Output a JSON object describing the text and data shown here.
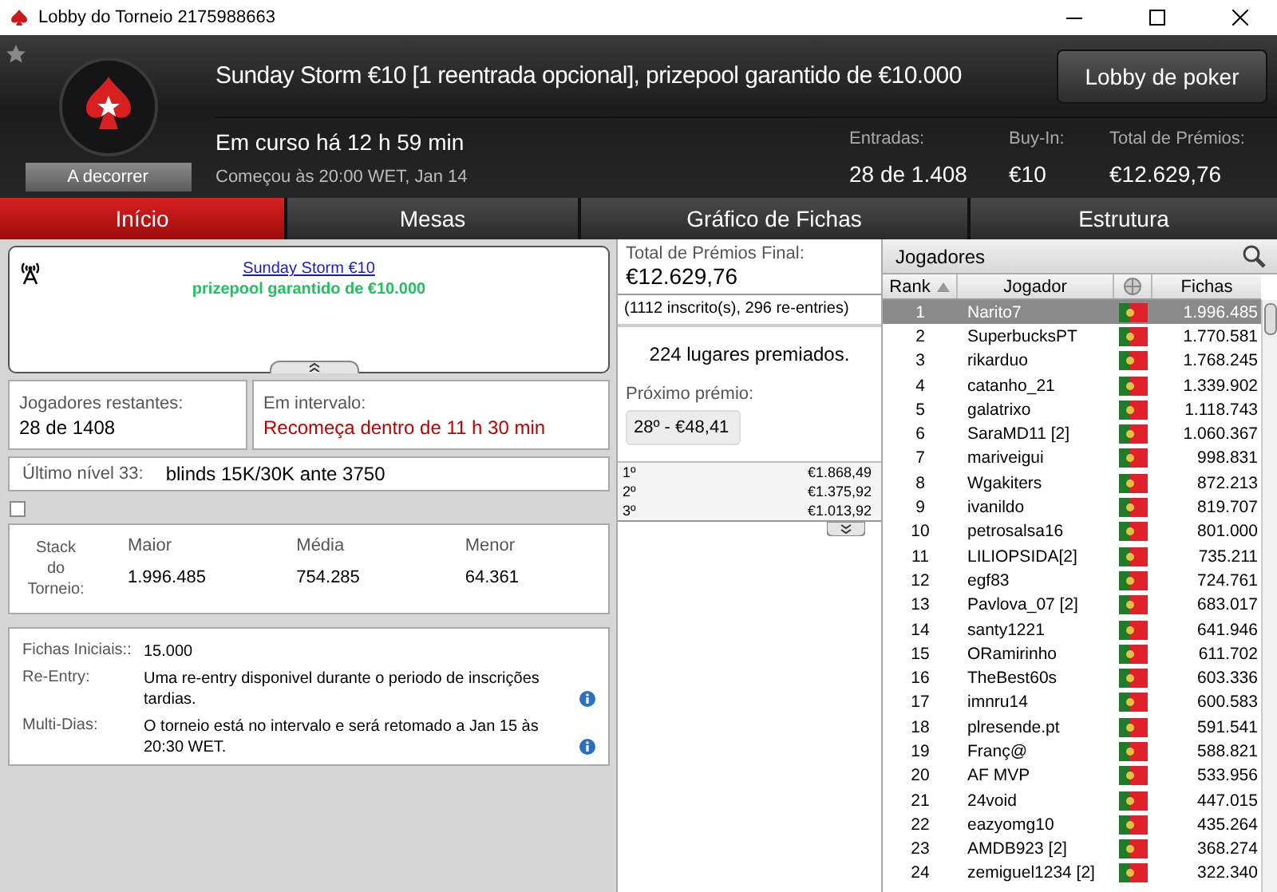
{
  "window": {
    "title": "Lobby do Torneio 2175988663"
  },
  "header": {
    "title": "Sunday Storm €10 [1 reentrada opcional], prizepool garantido de €10.000",
    "status_label": "A decorrer",
    "running": "Em curso há 12 h 59 min",
    "started": "Começou às 20:00 WET, Jan 14",
    "lobby_button": "Lobby de poker",
    "stats": [
      {
        "label": "Entradas:",
        "value": "28 de 1.408"
      },
      {
        "label": "Buy-In:",
        "value": "€10"
      },
      {
        "label": "Total de Prémios:",
        "value": "€12.629,76"
      }
    ]
  },
  "tabs": [
    {
      "label": "Início",
      "selected": true
    },
    {
      "label": "Mesas",
      "selected": false
    },
    {
      "label": "Gráfico de Fichas",
      "selected": false
    },
    {
      "label": "Estrutura",
      "selected": false
    }
  ],
  "news": {
    "link": "Sunday Storm €10",
    "subtitle": "prizepool garantido de €10.000"
  },
  "players_remaining": {
    "label": "Jogadores restantes:",
    "value": "28 de 1408"
  },
  "break": {
    "label": "Em intervalo:",
    "value": "Recomeça dentro de 11 h 30 min"
  },
  "last_level": {
    "label": "Último nível 33:",
    "value": "blinds 15K/30K ante 3750"
  },
  "option": {
    "checked": false
  },
  "stack": {
    "label": "Stack do Torneio:",
    "columns": [
      {
        "label": "Maior",
        "value": "1.996.485"
      },
      {
        "label": "Média",
        "value": "754.285"
      },
      {
        "label": "Menor",
        "value": "64.361"
      }
    ]
  },
  "info": [
    {
      "label": "Fichas Iniciais::",
      "value": "15.000",
      "info": false
    },
    {
      "label": "Re-Entry:",
      "value": "Uma re-entry disponivel durante o periodo de inscrições tardias.",
      "info": true
    },
    {
      "label": "Multi-Dias:",
      "value": "O torneio está no intervalo e será retomado a Jan 15 às 20:30 WET.",
      "info": true
    }
  ],
  "prizes": {
    "total_label": "Total de Prémios Final:",
    "total_value": "€12.629,76",
    "entries": "(1112 inscrito(s), 296 re-entries)",
    "paid": "224 lugares premiados.",
    "next_label": "Próximo prémio:",
    "next_value": "28º - €48,41",
    "places": [
      {
        "place": "1º",
        "amount": "€1.868,49"
      },
      {
        "place": "2º",
        "amount": "€1.375,92"
      },
      {
        "place": "3º",
        "amount": "€1.013,92"
      }
    ]
  },
  "players": {
    "title": "Jogadores",
    "columns": {
      "rank": "Rank",
      "player": "Jogador",
      "chips": "Fichas"
    },
    "rows": [
      {
        "rank": "1",
        "name": "Narito7",
        "chips": "1.996.485",
        "selected": true
      },
      {
        "rank": "2",
        "name": "SuperbucksPT",
        "chips": "1.770.581",
        "selected": false
      },
      {
        "rank": "3",
        "name": "rikarduo",
        "chips": "1.768.245",
        "selected": false
      },
      {
        "rank": "4",
        "name": "catanho_21",
        "chips": "1.339.902",
        "selected": false
      },
      {
        "rank": "5",
        "name": "galatrixo",
        "chips": "1.118.743",
        "selected": false
      },
      {
        "rank": "6",
        "name": "SaraMD11 [2]",
        "chips": "1.060.367",
        "selected": false
      },
      {
        "rank": "7",
        "name": "mariveigui",
        "chips": "998.831",
        "selected": false
      },
      {
        "rank": "8",
        "name": "Wgakiters",
        "chips": "872.213",
        "selected": false
      },
      {
        "rank": "9",
        "name": "ivanildo",
        "chips": "819.707",
        "selected": false
      },
      {
        "rank": "10",
        "name": "petrosalsa16",
        "chips": "801.000",
        "selected": false
      },
      {
        "rank": "11",
        "name": "LILIOPSIDA[2]",
        "chips": "735.211",
        "selected": false
      },
      {
        "rank": "12",
        "name": "egf83",
        "chips": "724.761",
        "selected": false
      },
      {
        "rank": "13",
        "name": "Pavlova_07 [2]",
        "chips": "683.017",
        "selected": false
      },
      {
        "rank": "14",
        "name": "santy1221",
        "chips": "641.946",
        "selected": false
      },
      {
        "rank": "15",
        "name": "ORamirinho",
        "chips": "611.702",
        "selected": false
      },
      {
        "rank": "16",
        "name": "TheBest60s",
        "chips": "603.336",
        "selected": false
      },
      {
        "rank": "17",
        "name": "imnru14",
        "chips": "600.583",
        "selected": false
      },
      {
        "rank": "18",
        "name": "plresende.pt",
        "chips": "591.541",
        "selected": false
      },
      {
        "rank": "19",
        "name": "Franç@",
        "chips": "588.821",
        "selected": false
      },
      {
        "rank": "20",
        "name": "AF MVP",
        "chips": "533.956",
        "selected": false
      },
      {
        "rank": "21",
        "name": "24void",
        "chips": "447.015",
        "selected": false
      },
      {
        "rank": "22",
        "name": "eazyomg10",
        "chips": "435.264",
        "selected": false
      },
      {
        "rank": "23",
        "name": "AMDB923 [2]",
        "chips": "368.274",
        "selected": false
      },
      {
        "rank": "24",
        "name": "zemiguel1234 [2]",
        "chips": "322.340",
        "selected": false
      }
    ]
  }
}
